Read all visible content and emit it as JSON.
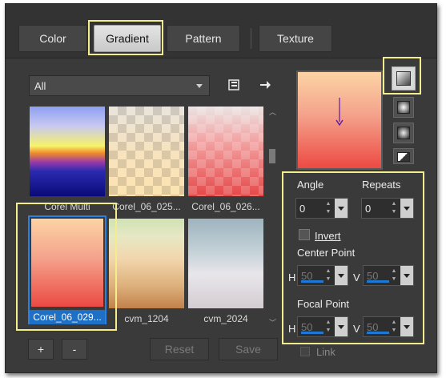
{
  "tabs": [
    {
      "label": "Color"
    },
    {
      "label": "Gradient"
    },
    {
      "label": "Pattern"
    },
    {
      "label": "Texture"
    }
  ],
  "library": {
    "category": "All",
    "swatches": [
      {
        "label": "Corel Multi"
      },
      {
        "label": "Corel_06_025..."
      },
      {
        "label": "Corel_06_026..."
      },
      {
        "label": "Corel_06_029..."
      },
      {
        "label": "cvm_1204"
      },
      {
        "label": "cvm_2024"
      }
    ]
  },
  "controls": {
    "angle_label": "Angle",
    "angle_value": "0",
    "repeats_label": "Repeats",
    "repeats_value": "0",
    "invert_label": "Invert",
    "center_point_label": "Center Point",
    "focal_point_label": "Focal Point",
    "h_label": "H",
    "v_label": "V",
    "center_h": "50",
    "center_v": "50",
    "focal_h": "50",
    "focal_v": "50",
    "link_label": "Link"
  },
  "buttons": {
    "add": "+",
    "remove": "-",
    "reset": "Reset",
    "save": "Save"
  },
  "colors": {
    "highlight": "#f3ee8b",
    "selection": "#1e6fc6",
    "accent_blue": "#1e78d6"
  },
  "icons": {
    "library_browse": "book-icon",
    "send_to": "arrow-right-icon"
  }
}
